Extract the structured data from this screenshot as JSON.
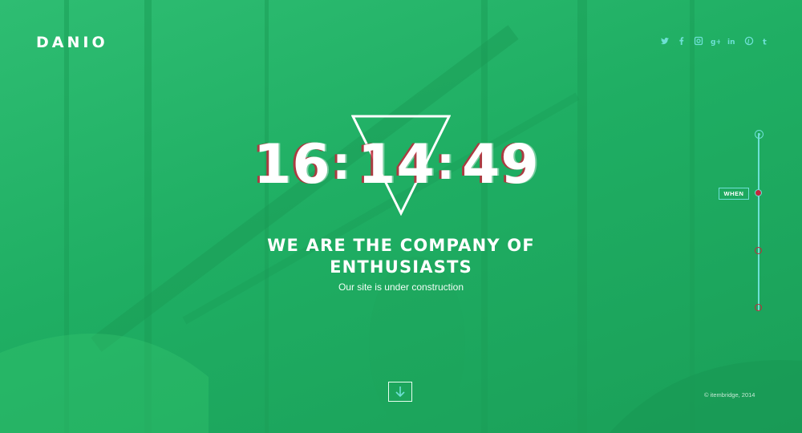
{
  "brand": {
    "name": "DANIO"
  },
  "social": [
    {
      "icon": "twitter-icon"
    },
    {
      "icon": "facebook-icon"
    },
    {
      "icon": "instagram-icon"
    },
    {
      "icon": "google-plus-icon"
    },
    {
      "icon": "linkedin-icon"
    },
    {
      "icon": "pinterest-icon"
    },
    {
      "icon": "tumblr-icon"
    }
  ],
  "countdown": {
    "hours": "16",
    "minutes": "14",
    "seconds": "49",
    "separator": ":"
  },
  "hero": {
    "headline_line1": "WE ARE THE COMPANY OF",
    "headline_line2": "ENTHUSIASTS",
    "subtitle": "Our site is under construction"
  },
  "timeline": {
    "active_label": "WHEN",
    "steps": [
      {
        "state": "done"
      },
      {
        "state": "active"
      },
      {
        "state": "upcoming"
      },
      {
        "state": "upcoming"
      }
    ]
  },
  "scroll_button": {
    "icon": "arrow-down-icon"
  },
  "footer": {
    "copyright": "© itembridge, 2014"
  },
  "colors": {
    "background": "#22b56a",
    "accent_cyan": "#6ee0d5",
    "accent_red": "#c3283c",
    "text": "#ffffff"
  }
}
